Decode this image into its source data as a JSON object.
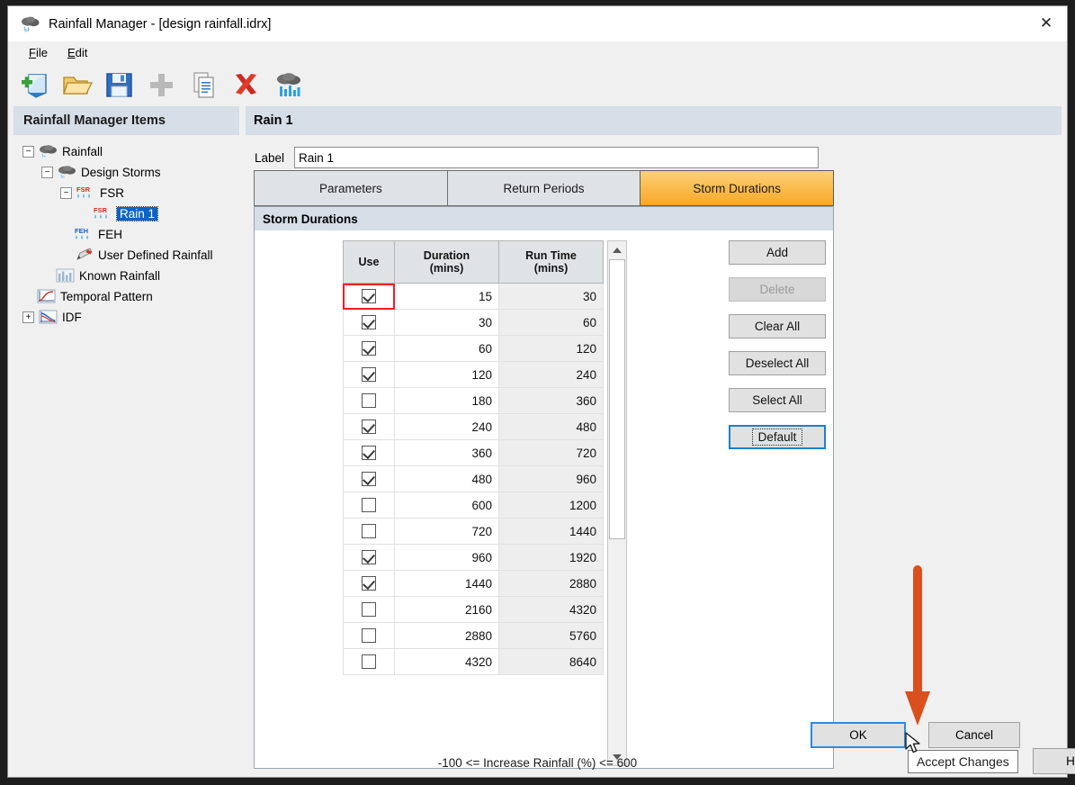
{
  "window": {
    "title": "Rainfall Manager - [design rainfall.idrx]",
    "title_icon": "rain-cloud-icon",
    "close_label": "✕"
  },
  "menubar": [
    {
      "label": "File",
      "accel": "F",
      "rest": "ile"
    },
    {
      "label": "Edit",
      "accel": "E",
      "rest": "dit"
    }
  ],
  "toolbar": [
    {
      "name": "new-icon"
    },
    {
      "name": "open-folder-icon"
    },
    {
      "name": "save-icon"
    },
    {
      "name": "add-plus-icon"
    },
    {
      "name": "copy-document-icon"
    },
    {
      "name": "delete-x-icon"
    },
    {
      "name": "rainfall-cloud-icon"
    }
  ],
  "tree_panel": {
    "header": "Rainfall Manager Items",
    "nodes": [
      {
        "label": "Rainfall",
        "indent": 0,
        "expander": "−",
        "icon": "rain-cloud-icon",
        "selected": false
      },
      {
        "label": "Design Storms",
        "indent": 1,
        "expander": "−",
        "icon": "rain-cloud-icon",
        "selected": false
      },
      {
        "label": "FSR",
        "indent": 2,
        "expander": "−",
        "icon": "fsr-icon",
        "selected": false
      },
      {
        "label": "Rain 1",
        "indent": 3,
        "expander": "",
        "icon": "fsr-icon",
        "selected": true
      },
      {
        "label": "FEH",
        "indent": 2,
        "expander": "",
        "icon": "feh-icon",
        "selected": false
      },
      {
        "label": "User Defined Rainfall",
        "indent": 2,
        "expander": "",
        "icon": "pencil-icon",
        "selected": false
      },
      {
        "label": "Known Rainfall",
        "indent": 1,
        "expander": "",
        "icon": "bar-rain-icon",
        "selected": false
      },
      {
        "label": "Temporal Pattern",
        "indent": 0,
        "expander": "",
        "icon": "curve-chart-icon",
        "selected": false
      },
      {
        "label": "IDF",
        "indent": 0,
        "expander": "+",
        "icon": "idf-chart-icon",
        "selected": false
      }
    ]
  },
  "detail": {
    "header": "Rain 1",
    "label_caption": "Label",
    "label_value": "Rain 1",
    "label_placeholder": "",
    "tabs": [
      {
        "label": "Parameters",
        "active": false
      },
      {
        "label": "Return Periods",
        "active": false
      },
      {
        "label": "Storm Durations",
        "active": true
      }
    ],
    "group_title": "Storm Durations",
    "grid": {
      "columns": [
        "Use",
        "Duration\n(mins)",
        "Run Time\n(mins)"
      ],
      "columns_display": [
        {
          "line1": "Use",
          "line2": ""
        },
        {
          "line1": "Duration",
          "line2": "(mins)"
        },
        {
          "line1": "Run Time",
          "line2": "(mins)"
        }
      ],
      "rows": [
        {
          "use": true,
          "duration": "15",
          "run_time": "30",
          "highlighted": true
        },
        {
          "use": true,
          "duration": "30",
          "run_time": "60",
          "highlighted": false
        },
        {
          "use": true,
          "duration": "60",
          "run_time": "120",
          "highlighted": false
        },
        {
          "use": true,
          "duration": "120",
          "run_time": "240",
          "highlighted": false
        },
        {
          "use": false,
          "duration": "180",
          "run_time": "360",
          "highlighted": false
        },
        {
          "use": true,
          "duration": "240",
          "run_time": "480",
          "highlighted": false
        },
        {
          "use": true,
          "duration": "360",
          "run_time": "720",
          "highlighted": false
        },
        {
          "use": true,
          "duration": "480",
          "run_time": "960",
          "highlighted": false
        },
        {
          "use": false,
          "duration": "600",
          "run_time": "1200",
          "highlighted": false
        },
        {
          "use": false,
          "duration": "720",
          "run_time": "1440",
          "highlighted": false
        },
        {
          "use": true,
          "duration": "960",
          "run_time": "1920",
          "highlighted": false
        },
        {
          "use": true,
          "duration": "1440",
          "run_time": "2880",
          "highlighted": false
        },
        {
          "use": false,
          "duration": "2160",
          "run_time": "4320",
          "highlighted": false
        },
        {
          "use": false,
          "duration": "2880",
          "run_time": "5760",
          "highlighted": false
        },
        {
          "use": false,
          "duration": "4320",
          "run_time": "8640",
          "highlighted": false
        }
      ]
    },
    "side_buttons": [
      {
        "label": "Add",
        "state": "normal"
      },
      {
        "label": "Delete",
        "state": "disabled"
      },
      {
        "label": "Clear All",
        "state": "normal"
      },
      {
        "label": "Deselect All",
        "state": "normal"
      },
      {
        "label": "Select All",
        "state": "normal"
      },
      {
        "label": "Default",
        "state": "focused"
      }
    ]
  },
  "footer": {
    "ok_label": "OK",
    "cancel_label": "Cancel",
    "help_label": "Help",
    "status_text": "-100 <= Increase Rainfall (%) <= 600",
    "tooltip_text": "Accept Changes"
  },
  "annotation": {
    "arrow_color": "#d9501e",
    "arrow_target": "ok-button"
  },
  "colors": {
    "accent_tab": "#f7a828",
    "selection": "#0a64c8",
    "focus_border": "#2f8ae0",
    "highlight_cell": "#f02020",
    "panel_header": "#d6dee7"
  }
}
